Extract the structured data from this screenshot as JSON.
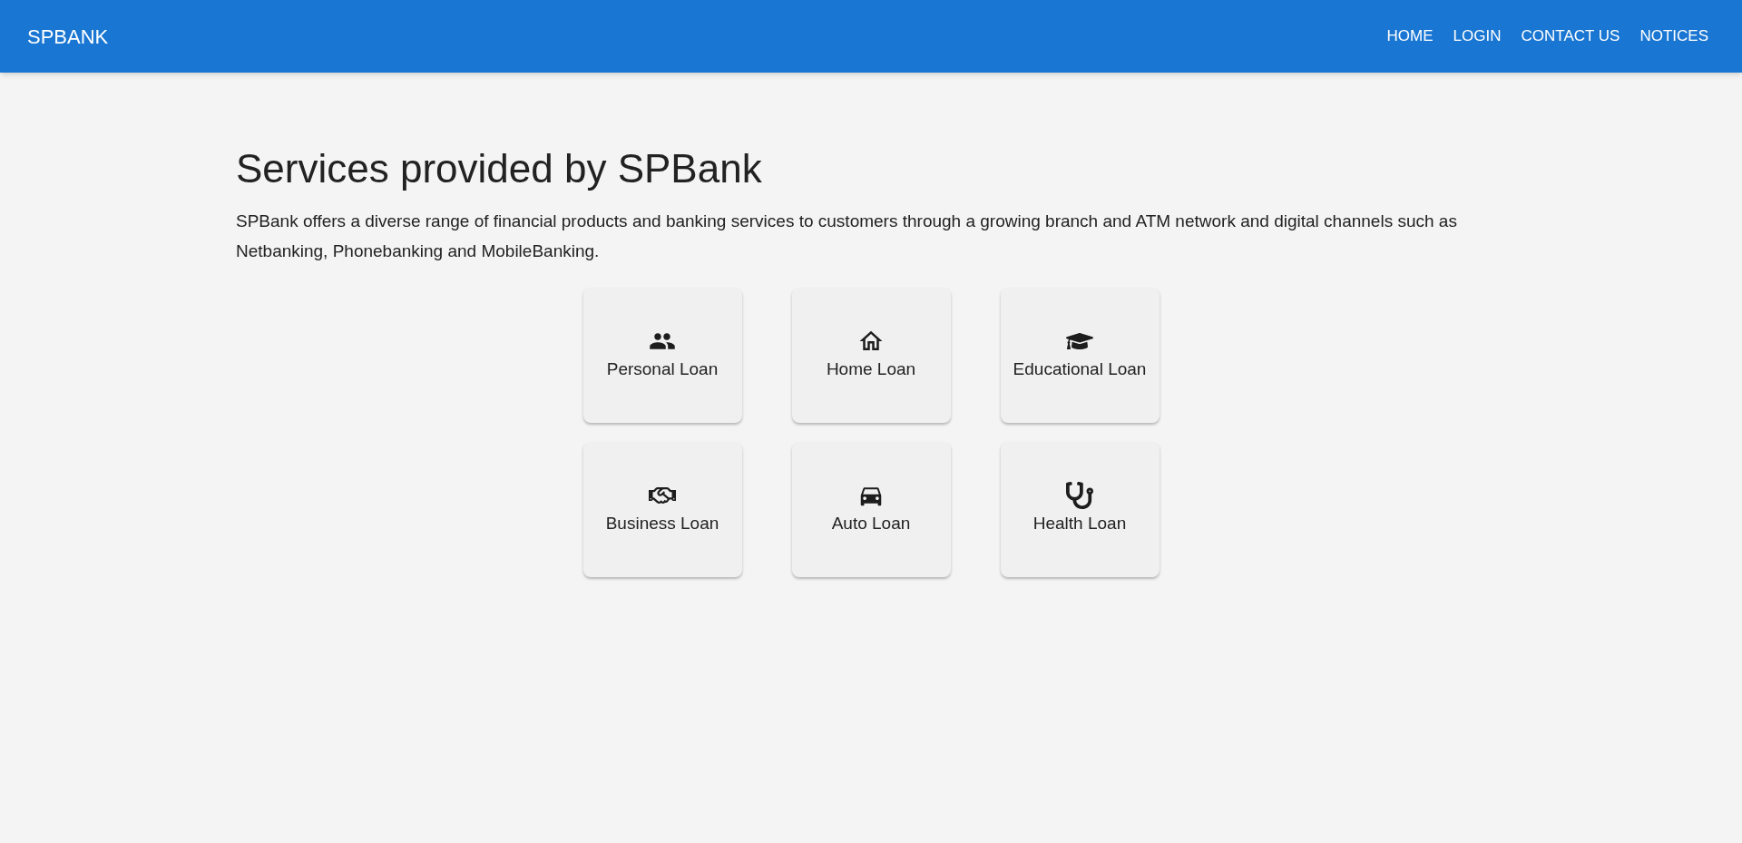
{
  "app_bar": {
    "brand": "SPBANK",
    "nav": [
      "HOME",
      "LOGIN",
      "CONTACT US",
      "NOTICES"
    ]
  },
  "heading": "Services provided by SPBank",
  "description": "SPBank offers a diverse range of financial products and banking services to customers through a growing branch and ATM network and digital channels such as Netbanking, Phonebanking and MobileBanking.",
  "services": [
    {
      "kind": "people",
      "label": "Personal Loan"
    },
    {
      "kind": "house",
      "label": "Home Loan"
    },
    {
      "kind": "graduation",
      "label": "Educational Loan"
    },
    {
      "kind": "handshake",
      "label": "Business Loan"
    },
    {
      "kind": "car",
      "label": "Auto Loan"
    },
    {
      "kind": "stethoscope",
      "label": "Health Loan"
    }
  ]
}
